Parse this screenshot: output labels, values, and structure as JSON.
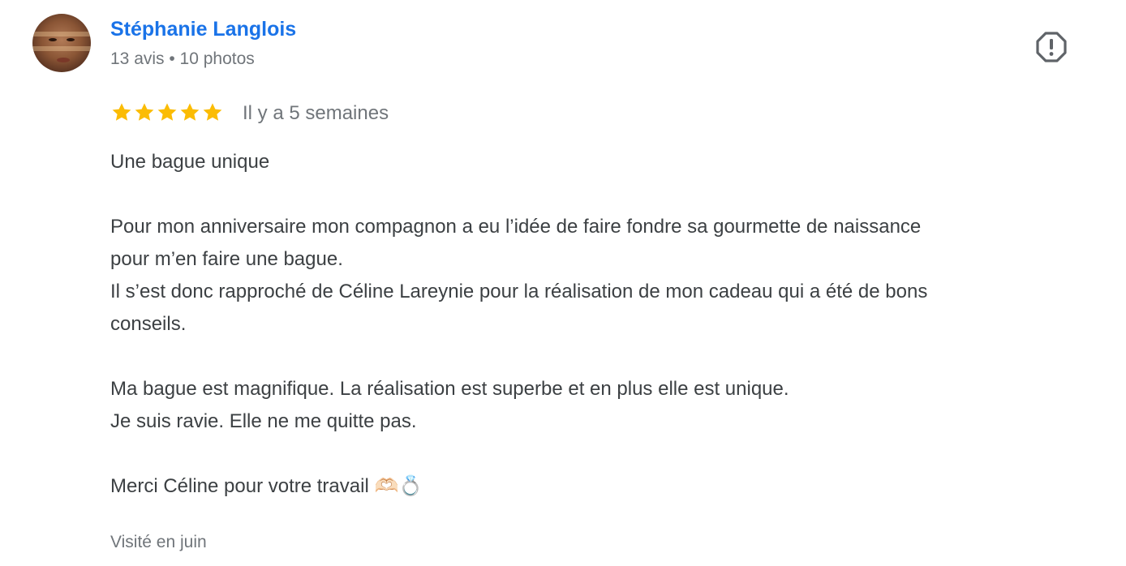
{
  "author": {
    "name": "Stéphanie Langlois",
    "meta": "13 avis • 10 photos"
  },
  "actions": {
    "report_icon": "report-flag-icon"
  },
  "review": {
    "rating": 5,
    "rating_max": 5,
    "star_color": "#fbbc04",
    "date": "Il y a 5 semaines",
    "lines": [
      "Une bague unique",
      "",
      "Pour mon anniversaire mon compagnon a eu l’idée de faire fondre sa gourmette de naissance",
      "pour m’en faire une bague.",
      "Il s’est donc rapproché de Céline Lareynie pour la réalisation de mon cadeau qui a été de bons",
      "conseils.",
      "",
      "Ma bague est magnifique. La réalisation est superbe et en plus elle est unique.",
      "Je suis ravie. Elle ne me quitte pas.",
      "",
      "Merci Céline pour votre travail 🫶🏻💍"
    ],
    "visited": "Visité en juin"
  },
  "colors": {
    "name": "#1a73e8",
    "meta": "#70757a",
    "text": "#3c4043"
  }
}
